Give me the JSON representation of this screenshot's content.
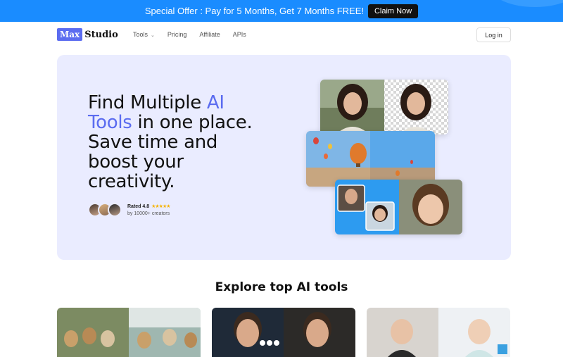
{
  "promo": {
    "text": "Special Offer : Pay for 5 Months, Get 7 Months FREE!",
    "cta": "Claim Now"
  },
  "nav": {
    "logo_box": "Max",
    "logo_text": "Studio",
    "items": [
      "Tools",
      "Pricing",
      "Affiliate",
      "APIs"
    ],
    "login": "Log in"
  },
  "hero": {
    "line1_a": "Find Multiple ",
    "line1_b": "AI",
    "line2_a": "Tools",
    "line2_b": " in one place.",
    "line3": "Save time and",
    "line4": "boost your",
    "line5": "creativity.",
    "rating_label": "Rated 4.8",
    "stars": "★★★★★",
    "rating_sub": "by 10000+ creators"
  },
  "section": {
    "title": "Explore top AI tools"
  },
  "colors": {
    "promo_bg": "#1a8cff",
    "accent": "#5b6cf0",
    "hero_bg": "#eaecff"
  }
}
